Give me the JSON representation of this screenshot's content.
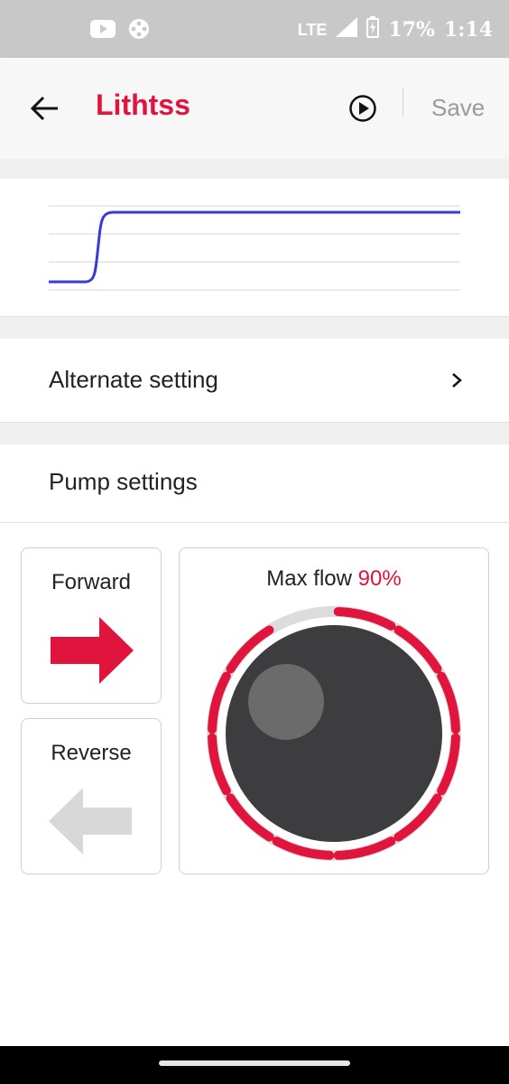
{
  "status_bar": {
    "network": "LTE",
    "battery": "17%",
    "time": "1:14",
    "icons": [
      "youtube-icon",
      "gamepad-icon",
      "signal-icon",
      "battery-charging-icon"
    ]
  },
  "app_bar": {
    "title": "Lithtss",
    "save_label": "Save",
    "title_color": "#e0143c",
    "icons": [
      "back-arrow-icon",
      "play-circle-icon"
    ]
  },
  "chart": {
    "line_color": "#3a3ad6",
    "step_curve": [
      [
        0.0,
        0.0
      ],
      [
        0.1,
        0.0
      ],
      [
        0.14,
        1.0
      ],
      [
        1.0,
        1.0
      ]
    ]
  },
  "alternate_setting": {
    "label": "Alternate setting",
    "icon": "chevron-right-icon"
  },
  "pump_settings": {
    "label": "Pump settings",
    "forward": {
      "label": "Forward",
      "selected": true,
      "icon": "arrow-right-icon",
      "color": "#e0143c"
    },
    "reverse": {
      "label": "Reverse",
      "selected": false,
      "icon": "arrow-left-icon",
      "color": "#d8d8d8"
    },
    "max_flow": {
      "label": "Max flow",
      "value": "90%",
      "value_fraction": 0.9,
      "accent": "#e0143c"
    }
  }
}
